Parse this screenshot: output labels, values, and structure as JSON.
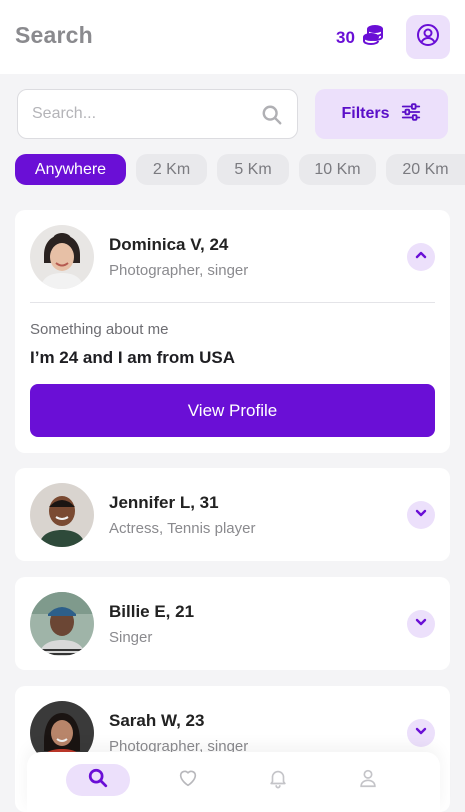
{
  "header": {
    "title": "Search",
    "coins": "30",
    "coins_icon": "coin-stack-icon",
    "profile_icon": "user-circle-icon"
  },
  "search": {
    "placeholder": "Search...",
    "icon": "search-icon"
  },
  "filters": {
    "label": "Filters",
    "icon": "sliders-icon"
  },
  "distance_chips": [
    {
      "label": "Anywhere",
      "active": true
    },
    {
      "label": "2 Km",
      "active": false
    },
    {
      "label": "5 Km",
      "active": false
    },
    {
      "label": "10 Km",
      "active": false
    },
    {
      "label": "20 Km",
      "active": false
    }
  ],
  "profiles": [
    {
      "name": "Dominica V, 24",
      "role": "Photographer, singer",
      "expanded": true,
      "about_label": "Something about me",
      "about_text": "I’m 24 and I am from USA",
      "view_button": "View Profile"
    },
    {
      "name": "Jennifer L, 31",
      "role": "Actress, Tennis player",
      "expanded": false
    },
    {
      "name": "Billie E, 21",
      "role": "Singer",
      "expanded": false
    },
    {
      "name": "Sarah W, 23",
      "role": "Photographer, singer",
      "expanded": false
    }
  ],
  "bottom_nav": [
    {
      "icon": "search-icon",
      "active": true
    },
    {
      "icon": "heart-icon",
      "active": false
    },
    {
      "icon": "bell-icon",
      "active": false
    },
    {
      "icon": "user-icon",
      "active": false
    }
  ],
  "colors": {
    "accent": "#6a0fd6",
    "accent_light": "#ece0fb",
    "background": "#f4f4f6"
  }
}
